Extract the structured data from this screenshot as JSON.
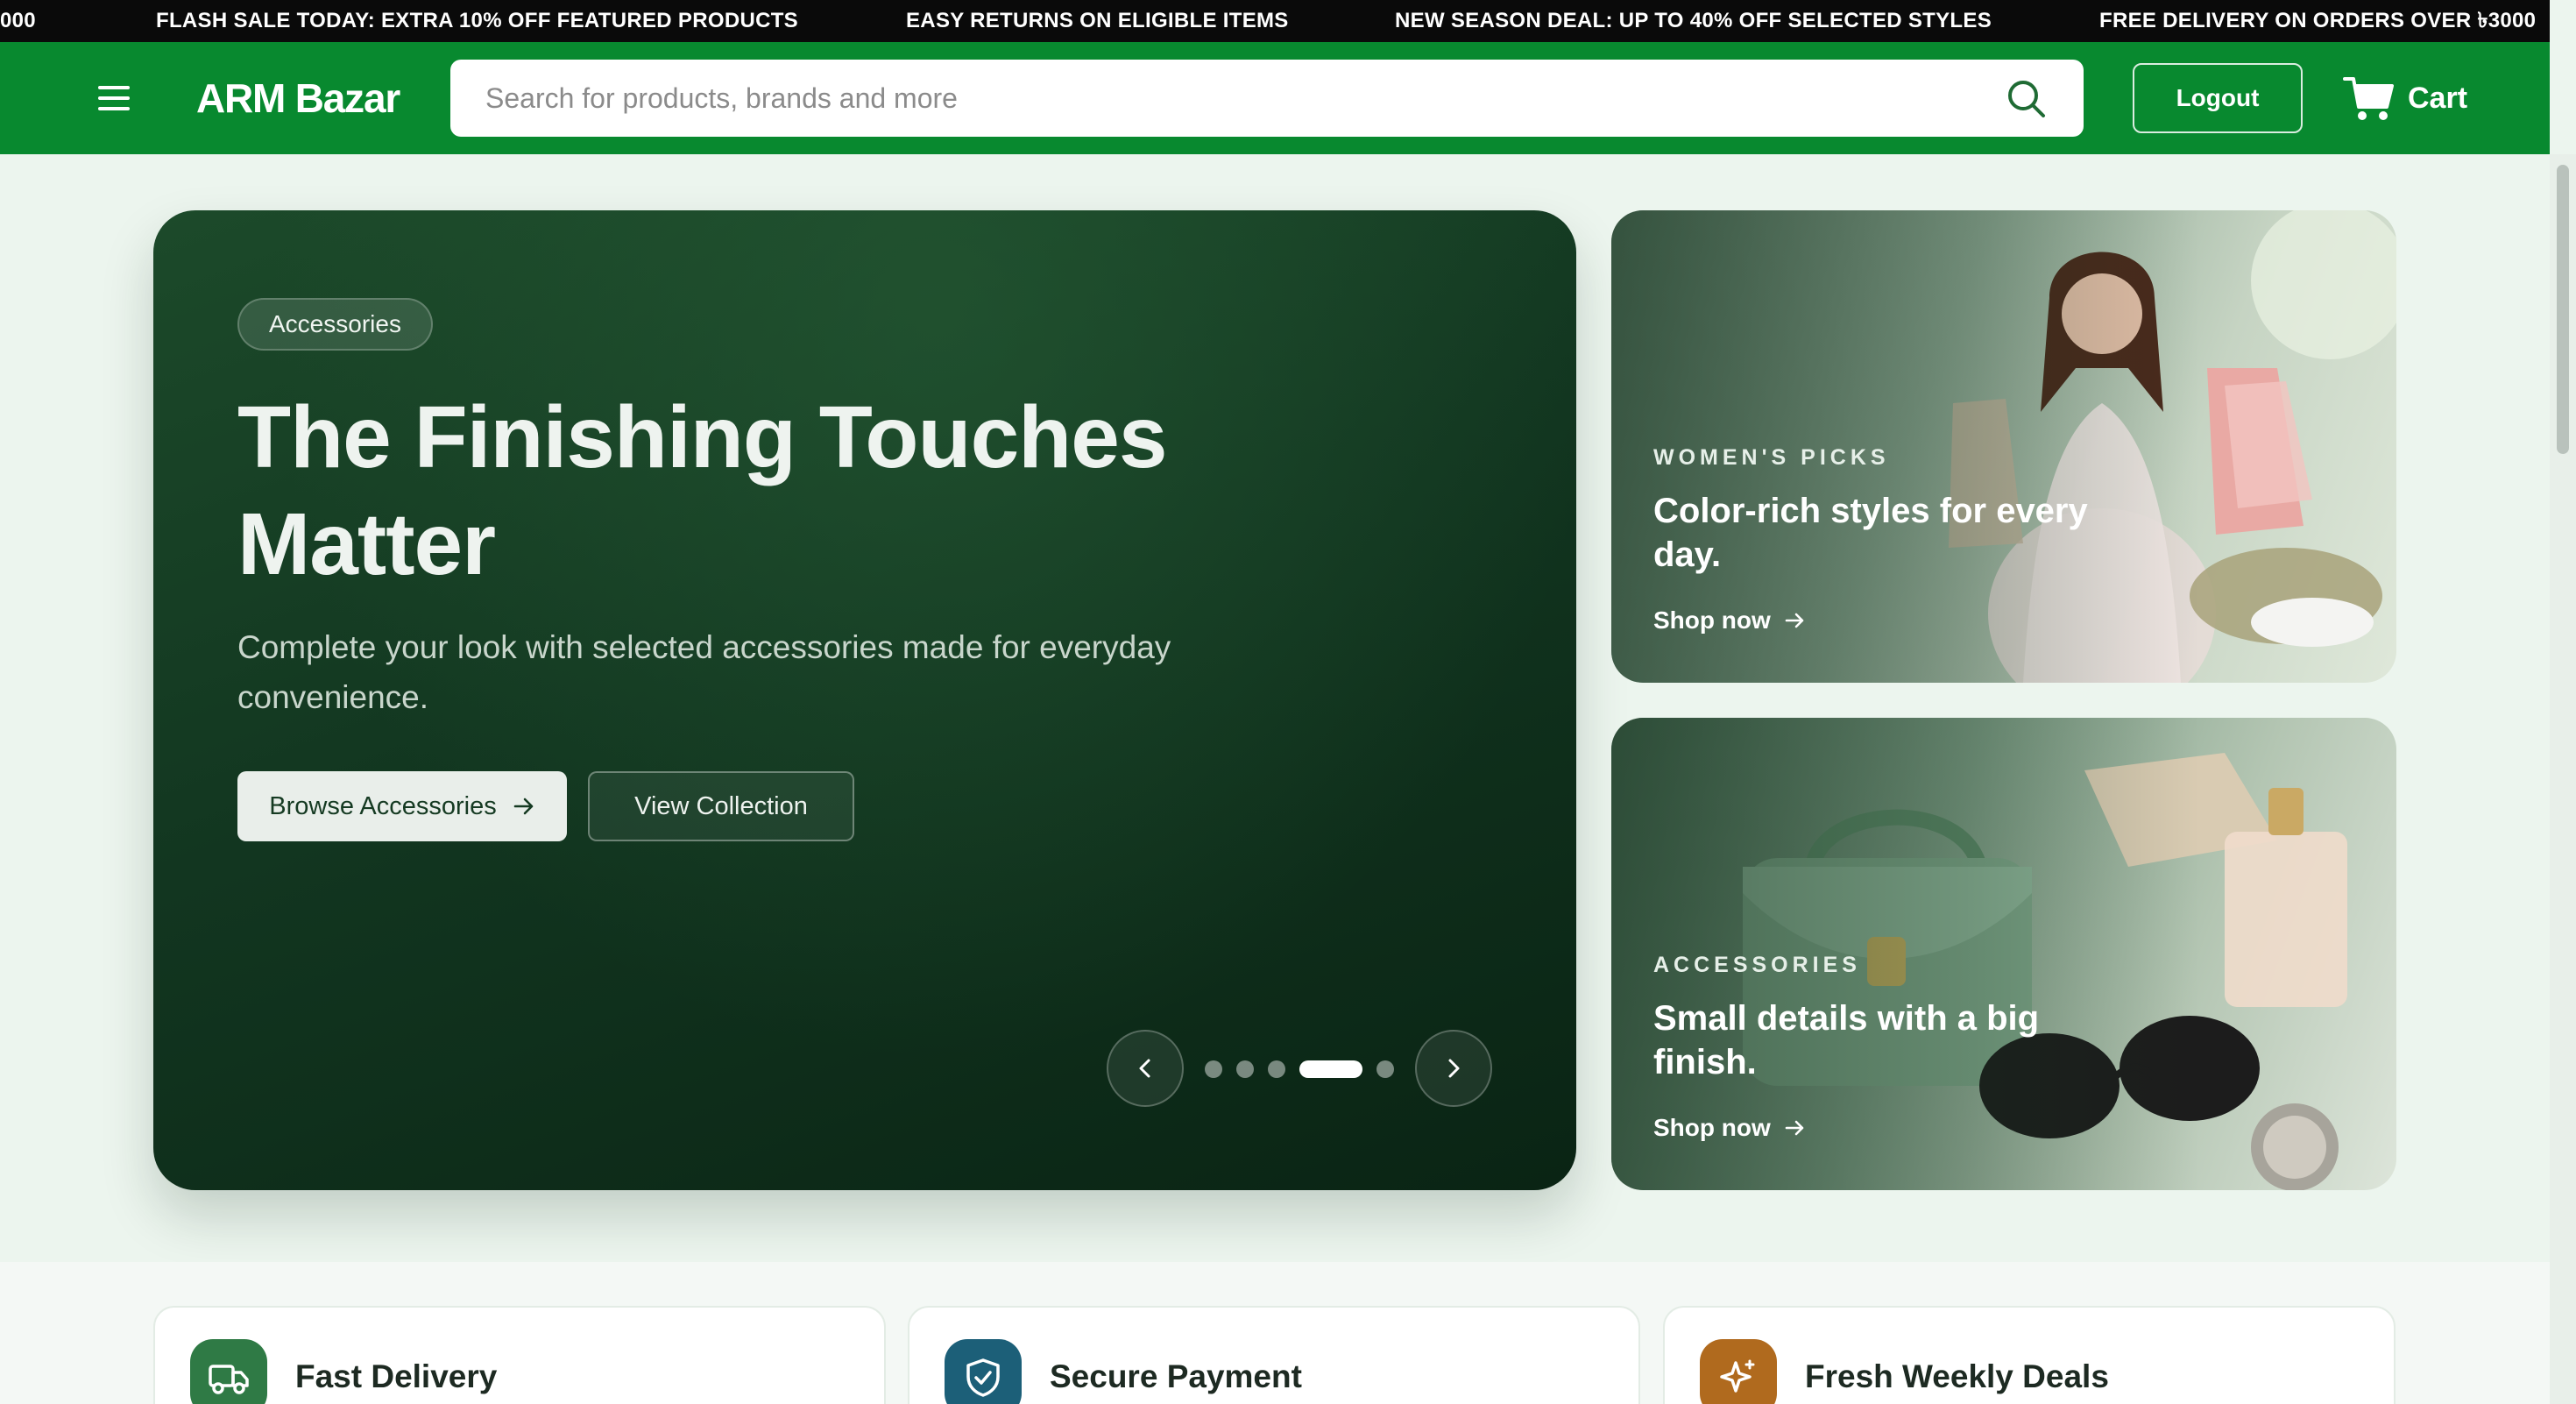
{
  "ticker": {
    "items": [
      "000",
      "FLASH SALE TODAY: EXTRA 10% OFF FEATURED PRODUCTS",
      "EASY RETURNS ON ELIGIBLE ITEMS",
      "NEW SEASON DEAL: UP TO 40% OFF SELECTED STYLES",
      "FREE DELIVERY ON ORDERS OVER ৳3000"
    ]
  },
  "header": {
    "menu_icon": "hamburger-menu-icon",
    "logo": "ARM Bazar",
    "search_placeholder": "Search for products, brands and more",
    "search_value": "",
    "search_icon": "search-icon",
    "logout_label": "Logout",
    "cart_label": "Cart",
    "cart_icon": "shopping-cart-icon"
  },
  "hero": {
    "badge": "Accessories",
    "title": "The Finishing Touches Matter",
    "subtitle": "Complete your look with selected accessories made for everyday convenience.",
    "primary_button": "Browse Accessories",
    "secondary_button": "View Collection",
    "slide_count": 5,
    "active_slide": 4
  },
  "promos": [
    {
      "kicker": "WOMEN'S PICKS",
      "title": "Color-rich styles for every day.",
      "link": "Shop now"
    },
    {
      "kicker": "ACCESSORIES",
      "title": "Small details with a big finish.",
      "link": "Shop now"
    }
  ],
  "features": [
    {
      "label": "Fast Delivery",
      "icon": "truck-icon",
      "color": "#2f7a45"
    },
    {
      "label": "Secure Payment",
      "icon": "shield-icon",
      "color": "#1c5f78"
    },
    {
      "label": "Fresh Weekly Deals",
      "icon": "sparkle-icon",
      "color": "#b06a1e"
    }
  ],
  "colors": {
    "brand_green": "#08892f",
    "hero_dark": "#123620",
    "ticker_bg": "#0a0a0a"
  }
}
